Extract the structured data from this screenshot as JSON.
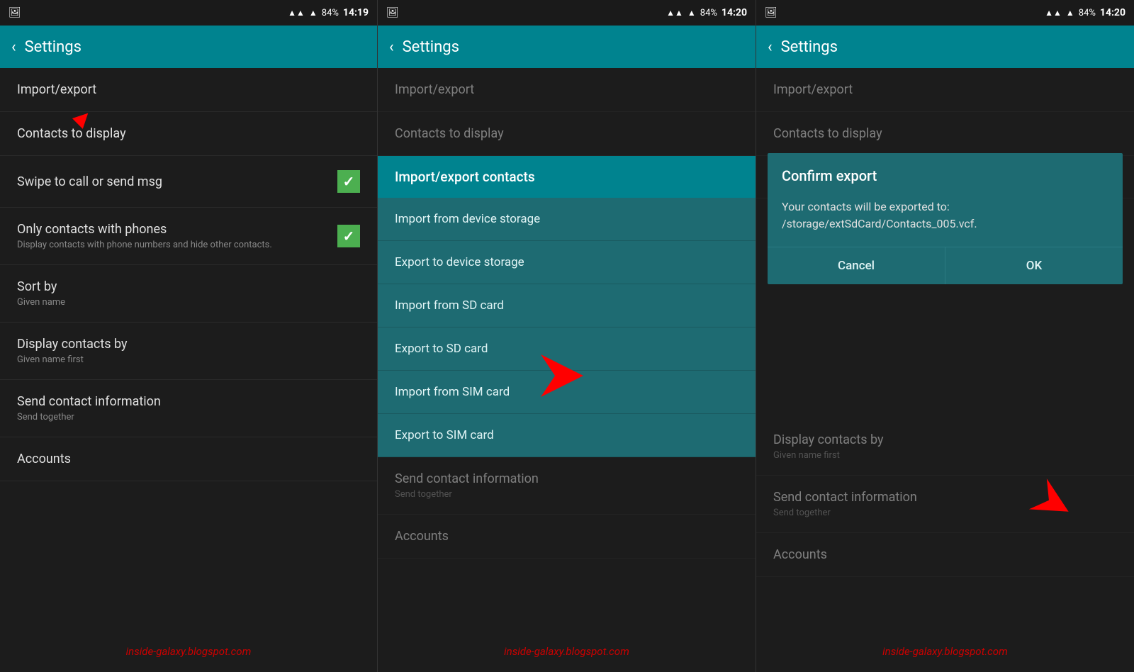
{
  "panels": [
    {
      "id": "panel1",
      "status": {
        "left_icon": "📷",
        "signal": "▲▲▲",
        "wifi": "▲",
        "battery": "84%",
        "time": "14:19"
      },
      "toolbar": {
        "back_label": "‹",
        "title": "Settings"
      },
      "items": [
        {
          "id": "import-export",
          "title": "Import/export",
          "subtitle": "",
          "has_checkbox": false,
          "has_arrow": true
        },
        {
          "id": "contacts-to-display",
          "title": "Contacts to display",
          "subtitle": "",
          "has_checkbox": false
        },
        {
          "id": "swipe-to-call",
          "title": "Swipe to call or send msg",
          "subtitle": "",
          "has_checkbox": true,
          "checked": true
        },
        {
          "id": "only-contacts-phones",
          "title": "Only contacts with phones",
          "subtitle": "Display contacts with phone numbers and hide other contacts.",
          "has_checkbox": true,
          "checked": true
        },
        {
          "id": "sort-by",
          "title": "Sort by",
          "subtitle": "Given name",
          "has_checkbox": false
        },
        {
          "id": "display-contacts-by",
          "title": "Display contacts by",
          "subtitle": "Given name first",
          "has_checkbox": false
        },
        {
          "id": "send-contact-info",
          "title": "Send contact information",
          "subtitle": "Send together",
          "has_checkbox": false
        },
        {
          "id": "accounts",
          "title": "Accounts",
          "subtitle": "",
          "has_checkbox": false
        }
      ],
      "watermark": "inside-galaxy.blogspot.com"
    },
    {
      "id": "panel2",
      "status": {
        "left_icon": "📷",
        "signal": "▲▲▲",
        "wifi": "▲",
        "battery": "84%",
        "time": "14:20"
      },
      "toolbar": {
        "back_label": "‹",
        "title": "Settings"
      },
      "bg_items": [
        {
          "id": "import-export-bg",
          "title": "Import/export"
        },
        {
          "id": "contacts-to-display-bg",
          "title": "Contacts to display"
        }
      ],
      "menu": {
        "header": "Import/export contacts",
        "items": [
          "Import from device storage",
          "Export to device storage",
          "Import from SD card",
          "Export to SD card",
          "Import from SIM card",
          "Export to SIM card"
        ]
      },
      "bg_bottom_items": [
        {
          "id": "send-contact-info-bg",
          "title": "Send contact information",
          "subtitle": "Send together"
        },
        {
          "id": "accounts-bg",
          "title": "Accounts"
        }
      ],
      "watermark": "inside-galaxy.blogspot.com"
    },
    {
      "id": "panel3",
      "status": {
        "left_icon": "📷",
        "signal": "▲▲▲",
        "wifi": "▲",
        "battery": "84%",
        "time": "14:20"
      },
      "toolbar": {
        "back_label": "‹",
        "title": "Settings"
      },
      "bg_items": [
        {
          "id": "import-export-bg3",
          "title": "Import/export"
        },
        {
          "id": "contacts-to-display-bg3",
          "title": "Contacts to display"
        }
      ],
      "dialog": {
        "title": "Confirm export",
        "body": "Your contacts will be exported to: /storage/extSdCard/Contacts_005.vcf.",
        "cancel": "Cancel",
        "ok": "OK"
      },
      "bg_bottom_items": [
        {
          "id": "display-contacts-by-bg3",
          "title": "Display contacts by",
          "subtitle": "Given name first"
        },
        {
          "id": "send-contact-info-bg3",
          "title": "Send contact information",
          "subtitle": "Send together"
        },
        {
          "id": "accounts-bg3",
          "title": "Accounts"
        }
      ],
      "watermark": "inside-galaxy.blogspot.com"
    }
  ]
}
